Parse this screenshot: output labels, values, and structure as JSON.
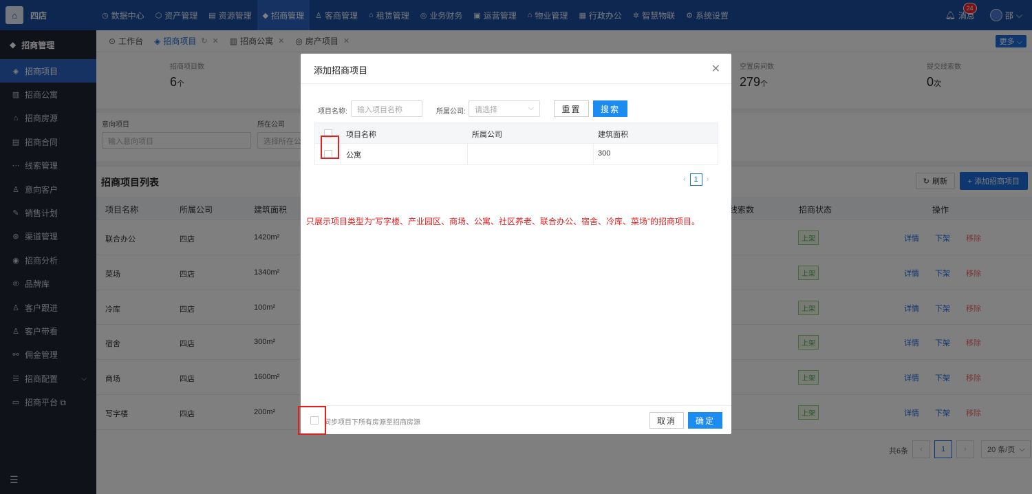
{
  "brand": {
    "logo_glyph": "⌂",
    "name": "四店"
  },
  "nav": [
    {
      "icon": "◷",
      "label": "数据中心"
    },
    {
      "icon": "⬡",
      "label": "资产管理"
    },
    {
      "icon": "▤",
      "label": "资源管理"
    },
    {
      "icon": "◆",
      "label": "招商管理"
    },
    {
      "icon": "♙",
      "label": "客商管理"
    },
    {
      "icon": "⌂",
      "label": "租赁管理"
    },
    {
      "icon": "◎",
      "label": "业务财务"
    },
    {
      "icon": "▣",
      "label": "运营管理"
    },
    {
      "icon": "⌂",
      "label": "物业管理"
    },
    {
      "icon": "▦",
      "label": "行政办公"
    },
    {
      "icon": "✲",
      "label": "智慧物联"
    },
    {
      "icon": "⚙",
      "label": "系统设置"
    }
  ],
  "top_right": {
    "message_label": "消息",
    "message_count": "24",
    "user_name": "邵"
  },
  "sidebar": {
    "title": "招商管理",
    "items": [
      {
        "icon": "◈",
        "label": "招商项目"
      },
      {
        "icon": "▥",
        "label": "招商公寓"
      },
      {
        "icon": "⌂",
        "label": "招商房源"
      },
      {
        "icon": "▤",
        "label": "招商合同"
      },
      {
        "icon": "⋯",
        "label": "线索管理"
      },
      {
        "icon": "♙",
        "label": "意向客户"
      },
      {
        "icon": "✎",
        "label": "销售计划"
      },
      {
        "icon": "⊛",
        "label": "渠道管理"
      },
      {
        "icon": "◉",
        "label": "招商分析"
      },
      {
        "icon": "®",
        "label": "品牌库"
      },
      {
        "icon": "♙",
        "label": "客户跟进"
      },
      {
        "icon": "♙",
        "label": "客户带看"
      },
      {
        "icon": "⚯",
        "label": "佣金管理"
      },
      {
        "icon": "☰",
        "label": "招商配置"
      },
      {
        "icon": "▭",
        "label": "招商平台 ⧉"
      }
    ],
    "collapse_icon": "☰"
  },
  "tabs": [
    {
      "label": "工作台"
    },
    {
      "label": "招商项目"
    },
    {
      "label": "招商公寓"
    },
    {
      "label": "房产项目"
    }
  ],
  "more_label": "更多 ⌵",
  "stats": [
    {
      "label": "招商项目数",
      "value": "6",
      "unit": "个"
    },
    {
      "label": "空置房间数",
      "value": "279",
      "unit": "个"
    },
    {
      "label": "提交线索数",
      "value": "0",
      "unit": "次"
    }
  ],
  "filters": {
    "project_label": "意向项目",
    "project_placeholder": "输入意向项目",
    "company_label": "所在公司",
    "company_placeholder": "选择所在公"
  },
  "list": {
    "title": "招商项目列表",
    "refresh_label": "刷新",
    "add_label": "+ 添加招商项目",
    "headers": [
      "项目名称",
      "所属公司",
      "建筑面积",
      "线索数",
      "招商状态",
      "操作"
    ],
    "rows": [
      {
        "name": "联合办公",
        "company": "四店",
        "area": "1420m²",
        "status": "上架"
      },
      {
        "name": "菜场",
        "company": "四店",
        "area": "1340m²",
        "status": "上架"
      },
      {
        "name": "冷库",
        "company": "四店",
        "area": "100m²",
        "status": "上架"
      },
      {
        "name": "宿舍",
        "company": "四店",
        "area": "300m²",
        "status": "上架"
      },
      {
        "name": "商场",
        "company": "四店",
        "area": "1600m²",
        "status": "上架"
      },
      {
        "name": "写字楼",
        "company": "四店",
        "area": "200m²",
        "status": "上架"
      }
    ],
    "ops": {
      "detail": "详情",
      "down": "下架",
      "remove": "移除"
    },
    "pager": {
      "total": "共6条",
      "current": "1",
      "page_size": "20 条/页"
    }
  },
  "modal": {
    "title": "添加招商项目",
    "name_label": "项目名称:",
    "name_placeholder": "输入项目名称",
    "company_label": "所属公司:",
    "company_placeholder": "请选择",
    "reset_label": "重置",
    "search_label": "搜索",
    "table_headers": [
      "项目名称",
      "所属公司",
      "建筑面积"
    ],
    "rows": [
      {
        "name": "公寓",
        "company": "",
        "area": "300"
      }
    ],
    "pager_current": "1",
    "note": "只展示项目类型为“写字楼、产业园区、商场、公寓、社区养老、联合办公、宿舍、冷库、菜场”的招商项目。",
    "sync_label": "同步项目下所有房源至招商房源",
    "cancel_label": "取消",
    "ok_label": "确定"
  }
}
